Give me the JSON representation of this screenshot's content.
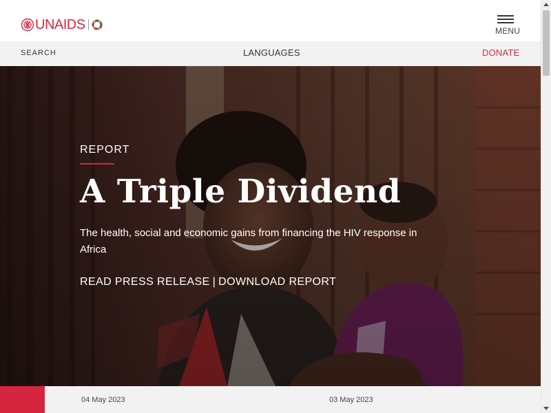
{
  "header": {
    "logo_text": "UNAIDS",
    "logo_emblem_icon": "un-emblem-icon",
    "logo_sdg_icon": "sdg-wheel-icon",
    "menu_icon": "hamburger-icon",
    "menu_label": "MENU"
  },
  "utility_bar": {
    "search_label": "SEARCH",
    "languages_label": "LANGUAGES",
    "donate_label": "DONATE"
  },
  "hero": {
    "kicker": "REPORT",
    "title": "A Triple Dividend",
    "subtitle": "The health, social and economic gains from financing the HIV response in Africa",
    "link_press": "READ PRESS RELEASE",
    "link_separator": "|",
    "link_download": "DOWNLOAD REPORT"
  },
  "news": {
    "items": [
      {
        "date": "04 May 2023"
      },
      {
        "date": "03 May 2023"
      }
    ]
  },
  "colors": {
    "brand_red": "#d6263f",
    "utility_bg": "#f2f2f2"
  }
}
